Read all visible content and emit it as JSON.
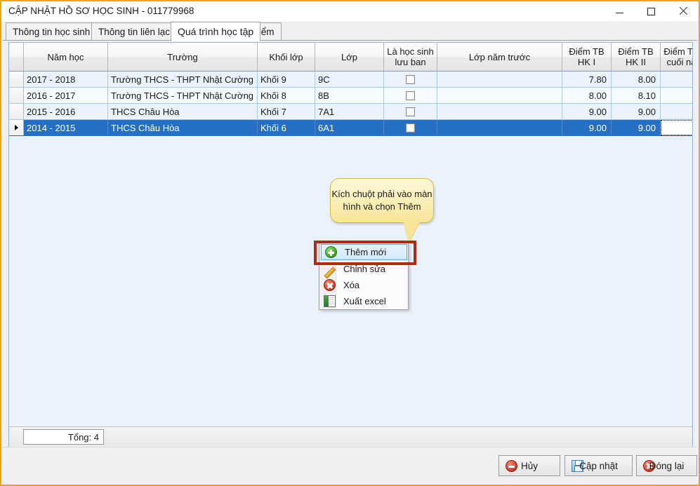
{
  "window": {
    "title": "CẬP NHẬT HỒ SƠ HỌC SINH - 011779968",
    "minimize_label": "−",
    "maximize_label": "□",
    "close_label": "✕",
    "border_color": "#f0a30a"
  },
  "tabs": [
    {
      "label": "Thông tin học sinh",
      "active": false
    },
    {
      "label": "Thông tin liên lạc",
      "active": false
    },
    {
      "label": "Quá trình học tập",
      "active": true
    },
    {
      "label": "Điểm",
      "active": false
    }
  ],
  "grid": {
    "columns": [
      {
        "label": "",
        "key": "rowhdr"
      },
      {
        "label": "Năm học",
        "key": "nam_hoc"
      },
      {
        "label": "Trường",
        "key": "truong"
      },
      {
        "label": "Khối lớp",
        "key": "khoi_lop"
      },
      {
        "label": "Lớp",
        "key": "lop"
      },
      {
        "label": "Là học sinh lưu ban",
        "key": "luu_ban"
      },
      {
        "label": "Lớp năm trước",
        "key": "lop_nam_truoc"
      },
      {
        "label": "Điểm TB HK I",
        "key": "dtb_hk1"
      },
      {
        "label": "Điểm TB HK II",
        "key": "dtb_hk2"
      },
      {
        "label": "Điểm TB cuối nă",
        "key": "dtb_cuoi_nam"
      }
    ],
    "rows": [
      {
        "nam_hoc": "2017 - 2018",
        "truong": "Trường THCS - THPT Nhật Cường ...",
        "khoi_lop": "Khối 9",
        "lop": "9C",
        "luu_ban": false,
        "lop_nam_truoc": "",
        "dtb_hk1": "7.80",
        "dtb_hk2": "8.00",
        "dtb_cuoi_nam": "",
        "selected": false
      },
      {
        "nam_hoc": "2016 - 2017",
        "truong": "Trường THCS - THPT Nhật Cường ...",
        "khoi_lop": "Khối 8",
        "lop": "8B",
        "luu_ban": false,
        "lop_nam_truoc": "",
        "dtb_hk1": "8.00",
        "dtb_hk2": "8.10",
        "dtb_cuoi_nam": "",
        "selected": false
      },
      {
        "nam_hoc": "2015 - 2016",
        "truong": "THCS Châu Hòa",
        "khoi_lop": "Khối 7",
        "lop": "7A1",
        "luu_ban": false,
        "lop_nam_truoc": "",
        "dtb_hk1": "9.00",
        "dtb_hk2": "9.00",
        "dtb_cuoi_nam": "",
        "selected": false
      },
      {
        "nam_hoc": "2014 - 2015",
        "truong": "THCS Châu Hòa",
        "khoi_lop": "Khối 6",
        "lop": "6A1",
        "luu_ban": false,
        "lop_nam_truoc": "",
        "dtb_hk1": "9.00",
        "dtb_hk2": "9.00",
        "dtb_cuoi_nam": "",
        "selected": true
      }
    ],
    "total_label": "Tổng: 4",
    "selection_color": "#2570c4",
    "row_color": "#eaf3fb"
  },
  "callout": {
    "text": "Kích chuột phải vào màn hình và chọn Thêm",
    "background": "#f7e59a",
    "border": "#d9b94e"
  },
  "context_menu": {
    "items": [
      {
        "label": "Thêm mới",
        "icon": "plus-circle-icon",
        "highlighted": true
      },
      {
        "label": "Chỉnh sửa",
        "icon": "pencil-icon",
        "highlighted": false
      },
      {
        "label": "Xóa",
        "icon": "delete-circle-icon",
        "highlighted": false
      },
      {
        "label": "Xuất excel",
        "icon": "excel-icon",
        "highlighted": false
      }
    ],
    "annotation_color": "#b02a14"
  },
  "footer_buttons": [
    {
      "label": "Hủy",
      "icon": "minus-circle-icon"
    },
    {
      "label": "Cập nhật",
      "icon": "save-icon"
    },
    {
      "label": "Đóng lại",
      "icon": "close-circle-icon"
    }
  ]
}
